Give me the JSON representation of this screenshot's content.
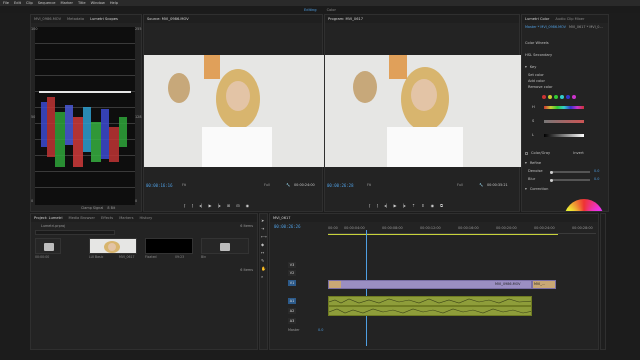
{
  "menu": [
    "File",
    "Edit",
    "Clip",
    "Sequence",
    "Marker",
    "Title",
    "Window",
    "Help"
  ],
  "workspace_tabs": [
    "Editing",
    "Color"
  ],
  "active_workspace": "Editing",
  "source_panel_tabs": [
    "MVI_0986.MOV",
    "Metadata",
    "Lumetri Scopes"
  ],
  "source_monitor_tab": "Source: MVI_0986.MOV",
  "program_monitor_tab": "Program: MVI_0617",
  "lumetri_color": {
    "tabs": [
      "Lumetri Color",
      "Audio Clip Mixer"
    ],
    "clip_path": "Master * MVI_0986.MOV",
    "clip_path2": "MVI_0617 * MVI_0...",
    "color_wheels": "Color Wheels",
    "hsl_secondary": "HSL Secondary",
    "key": "Key",
    "set_color": "Set color",
    "add_color": "Add color",
    "remove_color": "Remove color",
    "h": "H",
    "s": "S",
    "l": "L",
    "color_gray": "Color/Gray",
    "invert": "Invert",
    "refine": "Refine",
    "denoise": "Denoise",
    "denoise_value": "0.0",
    "blur": "Blur",
    "blur_value": "0.0",
    "correction": "Correction"
  },
  "scopes": {
    "clamp_signal": "Clamp Signal",
    "bit": "8 Bit",
    "left_labels": [
      "100",
      "90",
      "80",
      "70",
      "60",
      "50",
      "40",
      "30",
      "20",
      "10",
      "0"
    ],
    "right_labels": [
      "255",
      "230",
      "204",
      "179",
      "153",
      "128",
      "102",
      "77",
      "51",
      "26",
      "0"
    ]
  },
  "source_monitor": {
    "timecode": "00:00:16:16",
    "fit": "Fit",
    "duration": "00:00:24:00",
    "quality": "Full"
  },
  "program_monitor": {
    "timecode": "00:00:26:28",
    "fit": "Fit",
    "duration": "00:00:35:21",
    "quality": "Full"
  },
  "project": {
    "tabs": [
      "Project: Lumetri",
      "Media Browser",
      "Effects",
      "Markers",
      "History"
    ],
    "project_file": "Lumetri.prproj",
    "items_count": "6 Items",
    "bin_items": [
      {
        "name": "0 Bins",
        "meta": "00:00:00",
        "type": "folder"
      },
      {
        "name": "MVI_0617",
        "meta": "LUI Basic",
        "type": "thumb-face"
      },
      {
        "name": "Fixated",
        "meta": "09:23",
        "type": "black"
      },
      {
        "name": "Bin",
        "meta": "",
        "type": "folder"
      }
    ],
    "item_meta_right": "6 Items"
  },
  "timeline": {
    "tab": "MVI_0617",
    "timecode": "00:00:26:26",
    "ruler": [
      "00:00",
      "00:00:04:00",
      "00:00:08:00",
      "00:00:12:00",
      "00:00:16:00",
      "00:00:20:00",
      "00:00:24:00",
      "00:00:28:00"
    ],
    "video_tracks": [
      "V3",
      "V2",
      "V1"
    ],
    "audio_tracks": [
      "A1",
      "A2",
      "A3"
    ],
    "master": "Master",
    "master_value": "0.0",
    "video_clip_label": "MVI_0986.MOV",
    "video_clip2_label": "MVI_..."
  }
}
